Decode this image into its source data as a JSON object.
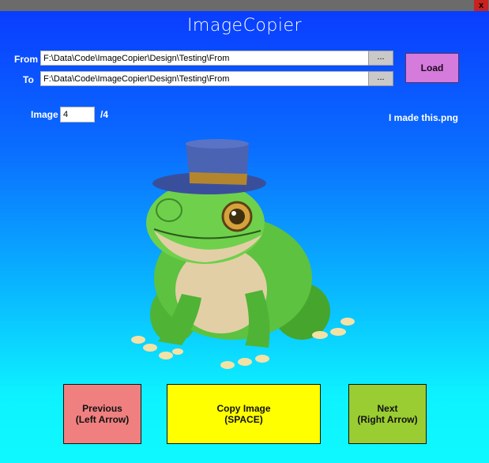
{
  "titlebar": {
    "close_glyph": "x"
  },
  "app": {
    "title": "ImageCopier"
  },
  "paths": {
    "from_label": "From",
    "from_value": "F:\\Data\\Code\\ImageCopier\\Design\\Testing\\From",
    "to_label": "To",
    "to_value": "F:\\Data\\Code\\ImageCopier\\Design\\Testing\\From",
    "browse_label": "..."
  },
  "load_label": "Load",
  "counter": {
    "label": "Image",
    "value": "4",
    "total": "/4"
  },
  "filename": "I made this.png",
  "image": {
    "icon": "frog-with-top-hat-image"
  },
  "buttons": {
    "previous_line1": "Previous",
    "previous_line2": "(Left Arrow)",
    "copy_line1": "Copy Image",
    "copy_line2": "(SPACE)",
    "next_line1": "Next",
    "next_line2": "(Right Arrow)"
  },
  "colors": {
    "previous": "#f08080",
    "copy": "#ffff00",
    "next": "#9acd32",
    "load": "#d57bdc",
    "close": "#c8211f"
  }
}
